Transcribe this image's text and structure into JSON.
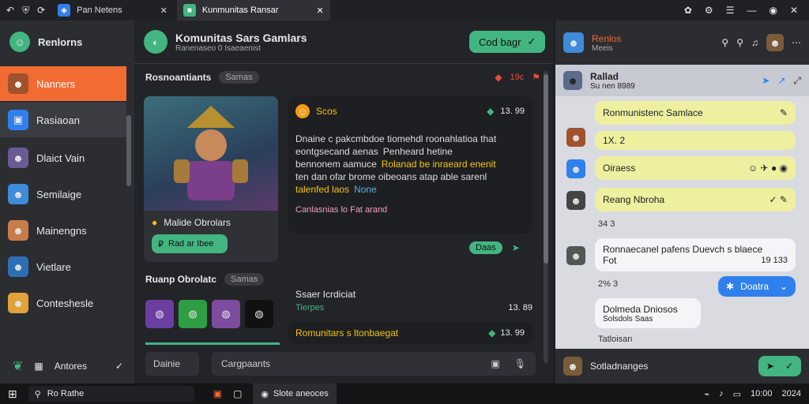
{
  "browser_tabs": [
    {
      "label": "Pan Netens",
      "active": false
    },
    {
      "label": "Kunmunitas Ransar",
      "active": true
    }
  ],
  "sidebar": {
    "app_name": "Renlorns",
    "items": [
      {
        "label": "Nanners",
        "state": "active"
      },
      {
        "label": "Rasiaoan",
        "state": "selected"
      },
      {
        "label": "Dlaict Vain",
        "state": ""
      },
      {
        "label": "Semilaige",
        "state": ""
      },
      {
        "label": "Mainengns",
        "state": ""
      },
      {
        "label": "Vietlare",
        "state": ""
      },
      {
        "label": "Conteshesle",
        "state": ""
      }
    ],
    "footer": "Antores"
  },
  "center": {
    "title": "Komunitas Sars Gamlars",
    "subtitle": "Ranenaseo 0 Isaeaenist",
    "top_button": "Cod bagr",
    "section1": {
      "title": "Rosnoantiants",
      "tag": "Samas",
      "badge": "19c"
    },
    "card": {
      "title": "Malide Obrolars",
      "button": "Rad ar Ibee"
    },
    "msg": {
      "author": "Scos",
      "time": "13. 99",
      "lines": [
        "Dnaine c pakcmbdoe tiomehdl roonahlatioa that",
        "eontgsecand aenas",
        "bennonem aamuce",
        "ten dan ofar brome oibeoans atap able sarenl",
        "talenfed laos"
      ],
      "inline": [
        "Penheard hetine",
        "Rolanad be inraeard enenit",
        "None"
      ],
      "footer": "Canlasnias lo Fat arand",
      "button": "Daas"
    },
    "section2": {
      "title": "Ruanp Obrolatc",
      "tag": "Samas"
    },
    "thread": {
      "label": "Ssaer Icrdiciat",
      "sub": "Tierpes",
      "time": "13. 89",
      "preview": "Romunitars s ltonbaegat",
      "time2": "13. 99"
    },
    "inputs": {
      "left": "Dainie",
      "main": "Cargpaants"
    }
  },
  "right": {
    "header": {
      "title": "Renlos",
      "sub": "Meeis"
    },
    "chat": {
      "title": "Rallad",
      "sub": "Su nen 8989"
    },
    "messages": [
      {
        "text": "Ronmunistenc Samlace",
        "type": "yellow"
      },
      {
        "text": "1X. 2",
        "type": "meta"
      },
      {
        "text": "Oiraess",
        "type": "yellow"
      },
      {
        "text": "Reang Nbroha",
        "type": "yellow"
      },
      {
        "text": "34 3",
        "type": "meta"
      },
      {
        "text": "Ronnaecanel pafens Duevch s blaece",
        "type": "white"
      },
      {
        "text": "Fot",
        "type": "white"
      },
      {
        "text": "19 133",
        "type": "meta"
      },
      {
        "text": "2% 3",
        "type": "meta"
      },
      {
        "text": "Doatra",
        "type": "blue"
      },
      {
        "text": "Dolmeda Dniosos",
        "type": "white"
      },
      {
        "text": "Solsdols Saas",
        "type": "white"
      },
      {
        "text": "Tatloisan",
        "type": "meta"
      }
    ],
    "input": "Sotladnanges"
  },
  "taskbar": {
    "search": "Ro Rathe",
    "window": "Slote aneoces",
    "time": "10:00",
    "date": "2024"
  },
  "colors": {
    "accent": "#f26b32",
    "green": "#43b581",
    "blue": "#2f80ed",
    "yellow_bubble": "#eef0a0"
  }
}
